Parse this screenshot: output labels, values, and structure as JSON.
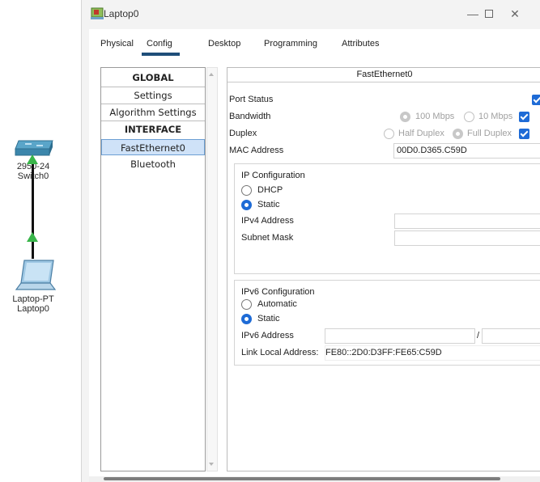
{
  "topology": {
    "switch": {
      "label_line1": "2950-24",
      "label_line2": "Switch0"
    },
    "laptop": {
      "label_line1": "Laptop-PT",
      "label_line2": "Laptop0"
    }
  },
  "window": {
    "title": "Laptop0",
    "controls": {
      "minimize": "—",
      "close": "✕"
    }
  },
  "tabs": [
    {
      "label": "Physical",
      "active": false
    },
    {
      "label": "Config",
      "active": true
    },
    {
      "label": "Desktop",
      "active": false
    },
    {
      "label": "Programming",
      "active": false
    },
    {
      "label": "Attributes",
      "active": false
    }
  ],
  "menu": {
    "global_header": "GLOBAL",
    "settings": "Settings",
    "algorithm_settings": "Algorithm Settings",
    "interface_header": "INTERFACE",
    "fastethernet0": "FastEthernet0",
    "bluetooth": "Bluetooth",
    "selected": "FastEthernet0"
  },
  "interface": {
    "title": "FastEthernet0",
    "port_status_label": "Port Status",
    "port_status_on": true,
    "bandwidth_label": "Bandwidth",
    "bandwidth_100": "100 Mbps",
    "bandwidth_10": "10 Mbps",
    "bandwidth_auto_checked": true,
    "duplex_label": "Duplex",
    "duplex_half": "Half Duplex",
    "duplex_full": "Full Duplex",
    "duplex_auto_checked": true,
    "mac_label": "MAC Address",
    "mac_value": "00D0.D365.C59D"
  },
  "ip_config": {
    "title": "IP Configuration",
    "dhcp": "DHCP",
    "static": "Static",
    "mode": "Static",
    "ipv4_label": "IPv4 Address",
    "ipv4_value": "",
    "subnet_label": "Subnet Mask",
    "subnet_value": ""
  },
  "ipv6_config": {
    "title": "IPv6 Configuration",
    "automatic": "Automatic",
    "static": "Static",
    "mode": "Static",
    "ipv6_label": "IPv6 Address",
    "ipv6_value": "",
    "prefix_separator": "/",
    "prefix_value": "",
    "link_local_label": "Link Local Address:",
    "link_local_value": "FE80::2D0:D3FF:FE65:C59D"
  },
  "colors": {
    "accent": "#1e6bd6",
    "tab_underline": "#1f4e79",
    "selected_bg": "#cfe2f8",
    "link_arrow": "#39b54a"
  }
}
